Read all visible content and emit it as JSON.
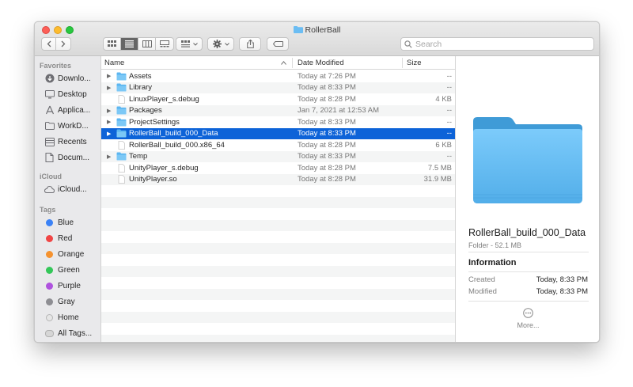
{
  "window": {
    "title": "RollerBall"
  },
  "search": {
    "placeholder": "Search"
  },
  "sidebar": {
    "favorites_heading": "Favorites",
    "favorites": [
      {
        "label": "Downlo...",
        "icon": "downloads-icon"
      },
      {
        "label": "Desktop",
        "icon": "desktop-icon"
      },
      {
        "label": "Applica...",
        "icon": "applications-icon"
      },
      {
        "label": "WorkD...",
        "icon": "folder-icon"
      },
      {
        "label": "Recents",
        "icon": "recents-icon"
      },
      {
        "label": "Docum...",
        "icon": "documents-icon"
      }
    ],
    "icloud_heading": "iCloud",
    "icloud": [
      {
        "label": "iCloud...",
        "icon": "cloud-icon"
      }
    ],
    "tags_heading": "Tags",
    "tags": [
      {
        "label": "Blue",
        "color": "#3b82f6"
      },
      {
        "label": "Red",
        "color": "#f04545"
      },
      {
        "label": "Orange",
        "color": "#f5922f"
      },
      {
        "label": "Green",
        "color": "#34c759"
      },
      {
        "label": "Purple",
        "color": "#af52de"
      },
      {
        "label": "Gray",
        "color": "#8e8e93"
      },
      {
        "label": "Home",
        "color": "#e6e6e6"
      },
      {
        "label": "All Tags...",
        "color": "#dcdcdc"
      }
    ]
  },
  "list": {
    "columns": {
      "name": "Name",
      "date": "Date Modified",
      "size": "Size"
    },
    "rows": [
      {
        "name": "Assets",
        "date": "Today at 7:26 PM",
        "size": "--",
        "kind": "folder"
      },
      {
        "name": "Library",
        "date": "Today at 8:33 PM",
        "size": "--",
        "kind": "folder"
      },
      {
        "name": "LinuxPlayer_s.debug",
        "date": "Today at 8:28 PM",
        "size": "4 KB",
        "kind": "file"
      },
      {
        "name": "Packages",
        "date": "Jan 7, 2021 at 12:53 AM",
        "size": "--",
        "kind": "folder"
      },
      {
        "name": "ProjectSettings",
        "date": "Today at 8:33 PM",
        "size": "--",
        "kind": "folder"
      },
      {
        "name": "RollerBall_build_000_Data",
        "date": "Today at 8:33 PM",
        "size": "--",
        "kind": "folder",
        "selected": true
      },
      {
        "name": "RollerBall_build_000.x86_64",
        "date": "Today at 8:28 PM",
        "size": "6 KB",
        "kind": "file"
      },
      {
        "name": "Temp",
        "date": "Today at 8:33 PM",
        "size": "--",
        "kind": "folder"
      },
      {
        "name": "UnityPlayer_s.debug",
        "date": "Today at 8:28 PM",
        "size": "7.5 MB",
        "kind": "file"
      },
      {
        "name": "UnityPlayer.so",
        "date": "Today at 8:28 PM",
        "size": "31.9 MB",
        "kind": "file"
      }
    ]
  },
  "preview": {
    "name": "RollerBall_build_000_Data",
    "subtitle": "Folder - 52.1 MB",
    "info_heading": "Information",
    "created_label": "Created",
    "created_value": "Today, 8:33 PM",
    "modified_label": "Modified",
    "modified_value": "Today, 8:33 PM",
    "more_label": "More..."
  },
  "colors": {
    "selection": "#0d63d8",
    "folder": "#5cb6f1"
  }
}
